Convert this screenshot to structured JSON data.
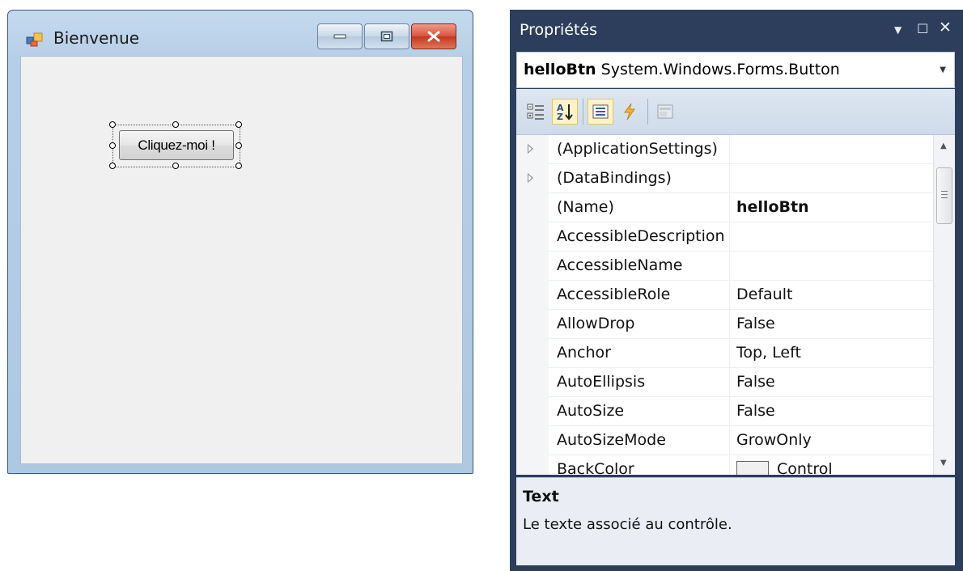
{
  "form": {
    "title": "Bienvenue",
    "button_text": "Cliquez-moi !"
  },
  "properties": {
    "title": "Propriétés",
    "object_name": "helloBtn",
    "object_type": "System.Windows.Forms.Button",
    "rows": [
      {
        "name": "(ApplicationSettings)",
        "value": "",
        "expandable": true
      },
      {
        "name": "(DataBindings)",
        "value": "",
        "expandable": true
      },
      {
        "name": "(Name)",
        "value": "helloBtn",
        "bold": true
      },
      {
        "name": "AccessibleDescription",
        "value": ""
      },
      {
        "name": "AccessibleName",
        "value": ""
      },
      {
        "name": "AccessibleRole",
        "value": "Default"
      },
      {
        "name": "AllowDrop",
        "value": "False"
      },
      {
        "name": "Anchor",
        "value": "Top, Left"
      },
      {
        "name": "AutoEllipsis",
        "value": "False"
      },
      {
        "name": "AutoSize",
        "value": "False"
      },
      {
        "name": "AutoSizeMode",
        "value": "GrowOnly"
      },
      {
        "name": "BackColor",
        "value": "Control",
        "swatch": "#f0f0f0"
      }
    ],
    "description_title": "Text",
    "description_text": "Le texte associé au contrôle."
  },
  "colors": {
    "panel_bg": "#2c3e5c",
    "form_frame": "#b7cfe6",
    "close_button": "#c3371f"
  }
}
